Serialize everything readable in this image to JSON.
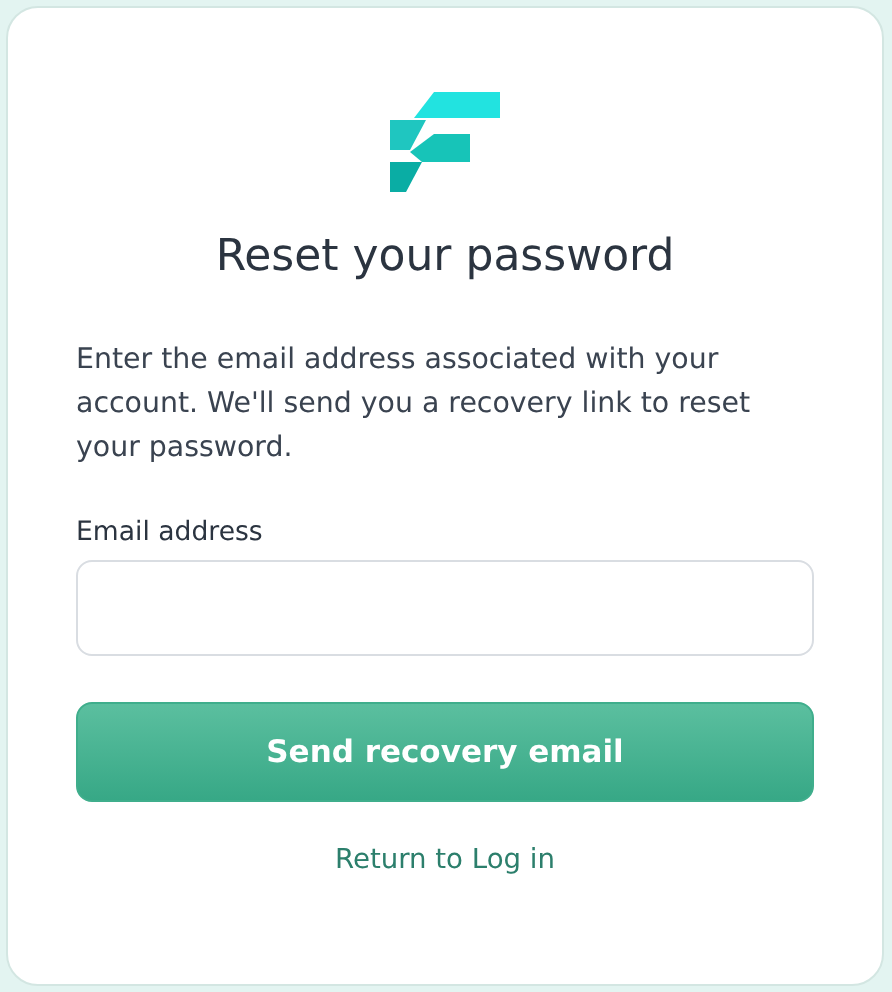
{
  "title": "Reset your password",
  "description": "Enter the email address associated with your account. We'll send you a recovery link to reset your password.",
  "email_field": {
    "label": "Email address"
  },
  "submit_button": "Send recovery email",
  "return_link": "Return to Log in"
}
